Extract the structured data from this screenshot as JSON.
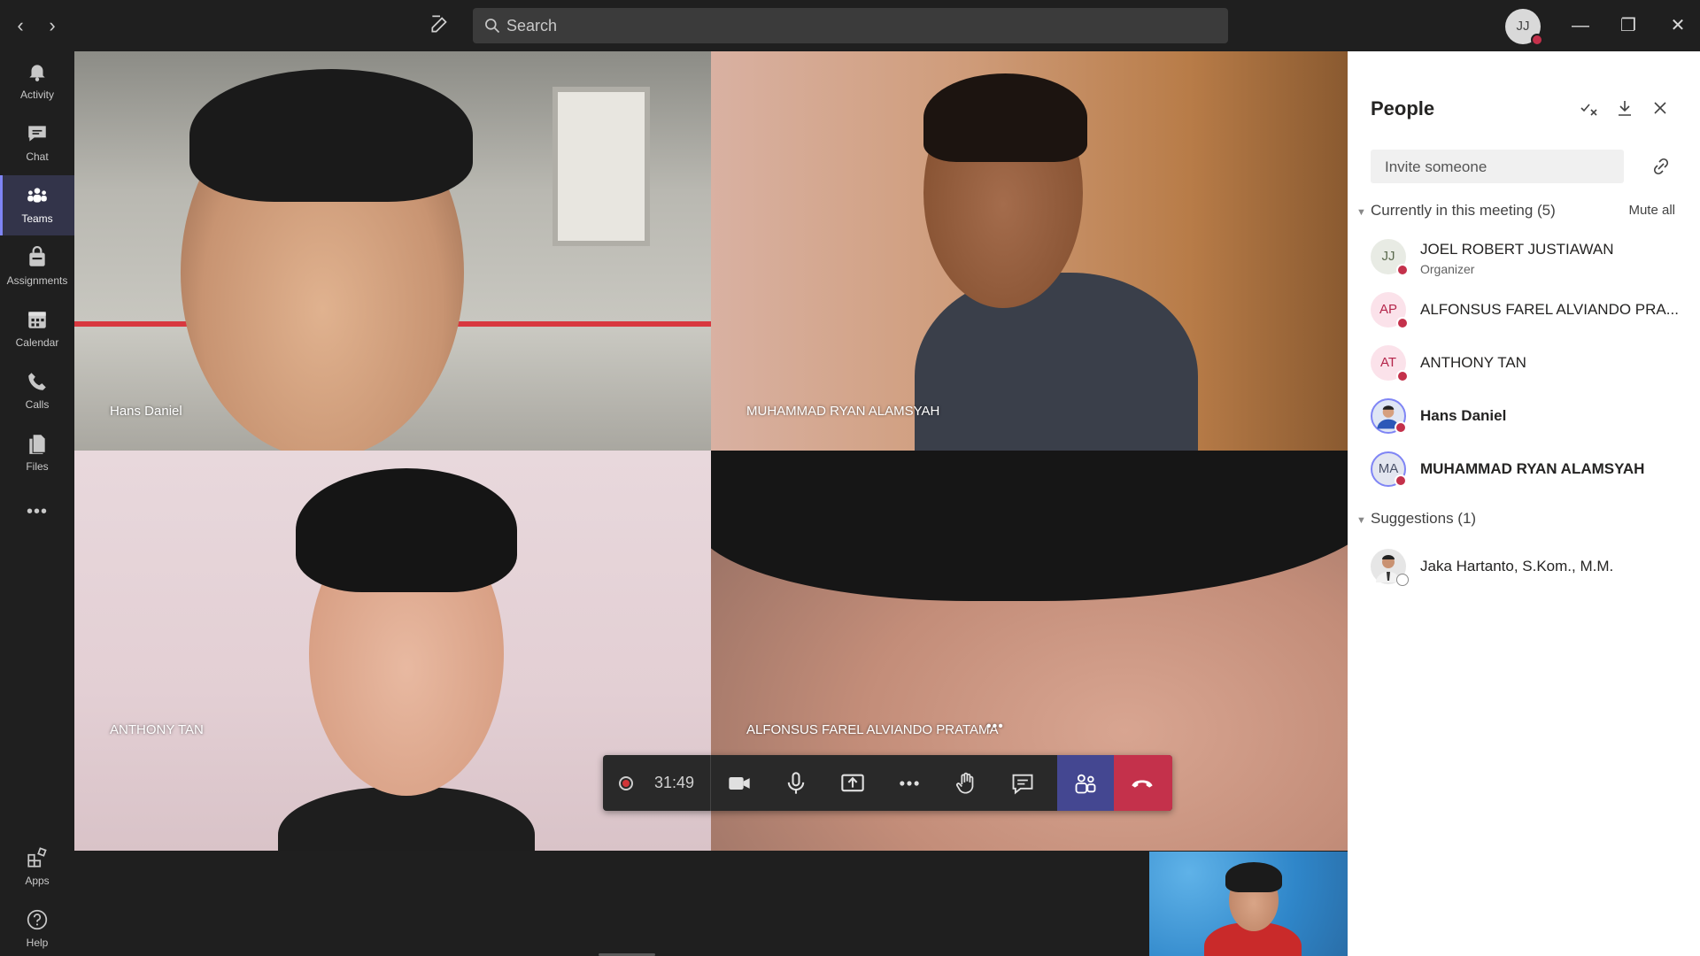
{
  "search": {
    "placeholder": "Search"
  },
  "user": {
    "initials": "JJ"
  },
  "rail": {
    "items": [
      {
        "label": "Activity",
        "icon": "bell-icon"
      },
      {
        "label": "Chat",
        "icon": "chat-icon"
      },
      {
        "label": "Teams",
        "icon": "teams-icon",
        "active": true
      },
      {
        "label": "Assignments",
        "icon": "assignments-icon"
      },
      {
        "label": "Calendar",
        "icon": "calendar-icon"
      },
      {
        "label": "Calls",
        "icon": "phone-icon"
      },
      {
        "label": "Files",
        "icon": "files-icon"
      }
    ],
    "more": "•••",
    "bottom": [
      {
        "label": "Apps",
        "icon": "apps-icon"
      },
      {
        "label": "Help",
        "icon": "help-icon"
      }
    ]
  },
  "tiles": [
    {
      "name": "Hans Daniel"
    },
    {
      "name": "MUHAMMAD RYAN ALAMSYAH"
    },
    {
      "name": "ANTHONY TAN"
    },
    {
      "name": "ALFONSUS FAREL ALVIANDO PRATAMA",
      "more": "•••"
    }
  ],
  "controls": {
    "timer": "31:49"
  },
  "people": {
    "title": "People",
    "invite_placeholder": "Invite someone",
    "current_section": "Currently in this meeting (5)",
    "mute_all": "Mute all",
    "participants": [
      {
        "initials": "JJ",
        "name": "JOEL ROBERT JUSTIAWAN",
        "role": "Organizer",
        "avatar_color": "#e8ebe4",
        "text_color": "#5c6b4f"
      },
      {
        "initials": "AP",
        "name": "ALFONSUS FAREL ALVIANDO PRA...",
        "avatar_color": "#fbe2ea",
        "text_color": "#b4254a"
      },
      {
        "initials": "AT",
        "name": "ANTHONY TAN",
        "avatar_color": "#fbe2ea",
        "text_color": "#b4254a"
      },
      {
        "initials": "",
        "name": "Hans Daniel",
        "bold": true
      },
      {
        "initials": "MA",
        "name": "MUHAMMAD RYAN ALAMSYAH",
        "bold": true,
        "avatar_color": "#e3e6f0",
        "text_color": "#4a5168"
      }
    ],
    "suggestions_section": "Suggestions (1)",
    "suggestions": [
      {
        "name": "Jaka Hartanto, S.Kom., M.M."
      }
    ]
  }
}
